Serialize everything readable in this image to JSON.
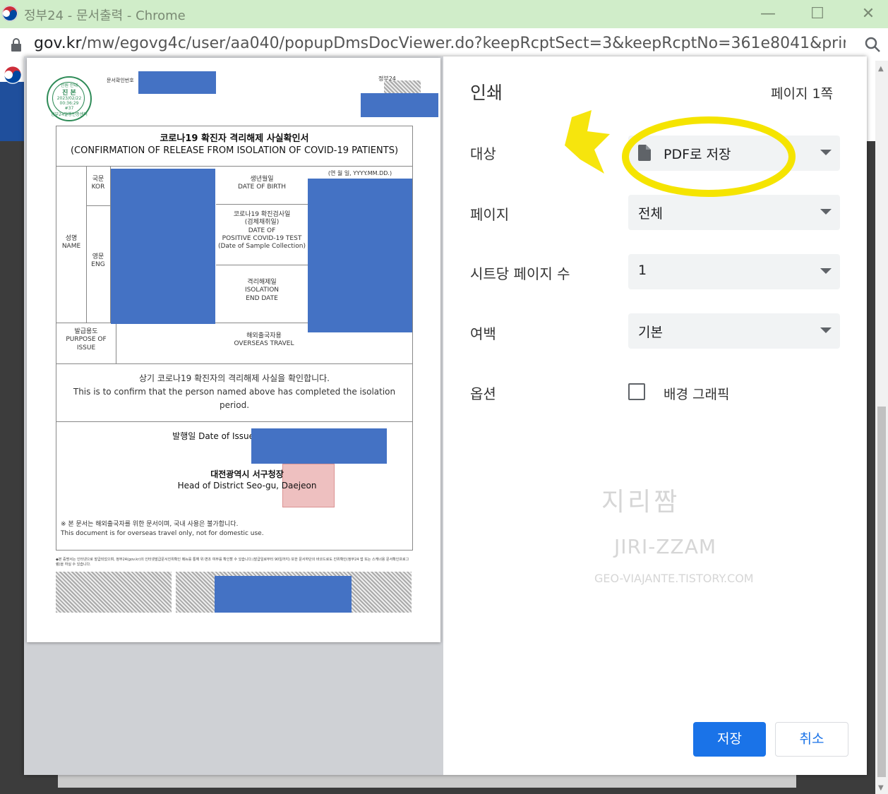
{
  "window": {
    "title": "정부24 - 문서출력 - Chrome",
    "url_host": "gov.kr",
    "url_path": "/mw/egovg4c/user/aa040/popupDmsDocViewer.do?keepRcptSect=3&keepRcptNo=361e8041&printAuth=Y..."
  },
  "document": {
    "doc_number_label": "문서확인번호",
    "gov24_label": "정부24",
    "seal_lines": [
      "민원 안내",
      "진 본",
      "2023/02/22",
      "00:36:29",
      "#37",
      "정부24발행인증센터"
    ],
    "title_ko": "코로나19 확진자 격리해제 사실확인서",
    "title_en": "(CONFIRMATION OF RELEASE FROM ISOLATION OF COVID-19 PATIENTS)",
    "name_label": "성명\nNAME",
    "kor_label": "국문\nKOR",
    "eng_label": "영문\nENG",
    "dob_label": "생년월일\nDATE OF BIRTH",
    "date_format": "(연 월 일, YYYY.MM.DD.)",
    "positive_label": "코로나19 확진검사일\n(검체채취일)\nDATE OF\nPOSITIVE COVID-19 TEST\n(Date of Sample Collection)",
    "iso_end_label": "격리해제일\nISOLATION\nEND DATE",
    "purpose_label": "발급용도\nPURPOSE OF\nISSUE",
    "purpose_value": "해외출국자용\nOVERSEAS TRAVEL",
    "confirm_ko": "상기 코로나19 확진자의 격리해제 사실을 확인합니다.",
    "confirm_en": "This is to confirm that the person named above has completed the isolation period.",
    "issue_label": "발행일 Date of Issue",
    "issuer_ko": "대전광역시 서구청장",
    "issuer_en": "Head of District Seo-gu, Daejeon",
    "note_ko": "※ 본 문서는 해외출국자를 위한 문서이며, 국내 사용은 불가합니다.",
    "note_en": "This document is for overseas travel only, not for domestic use.",
    "footer_note": "◆본 증명서는 인터넷으로 발급되었으며, 정부24(gov.kr)의 인터넷발급문서진위확인 메뉴를 통해 위·변조 여부를 확인할 수 있습니다.(발급일로부터 90일까지) 또한 문서하단의 바코드로도 진위확인(정부24 앱 또는 스캐너용 문서확인프로그램)을 하실 수 있습니다."
  },
  "print": {
    "title": "인쇄",
    "pages_summary": "페이지 1쪽",
    "destination_label": "대상",
    "destination_value": "PDF로 저장",
    "pages_label": "페이지",
    "pages_value": "전체",
    "per_sheet_label": "시트당 페이지 수",
    "per_sheet_value": "1",
    "margins_label": "여백",
    "margins_value": "기본",
    "options_label": "옵션",
    "background_graphics_label": "배경 그래픽",
    "background_graphics_checked": false,
    "save_button": "저장",
    "cancel_button": "취소"
  },
  "watermark": {
    "line1": "지리짬",
    "line2": "JIRI-ZZAM",
    "line3": "GEO-VIAJANTE.TISTORY.COM"
  },
  "colors": {
    "titlebar": "#d0edc9",
    "accent": "#1a73e8",
    "redaction": "#4472c4",
    "highlight": "#f5e400"
  }
}
